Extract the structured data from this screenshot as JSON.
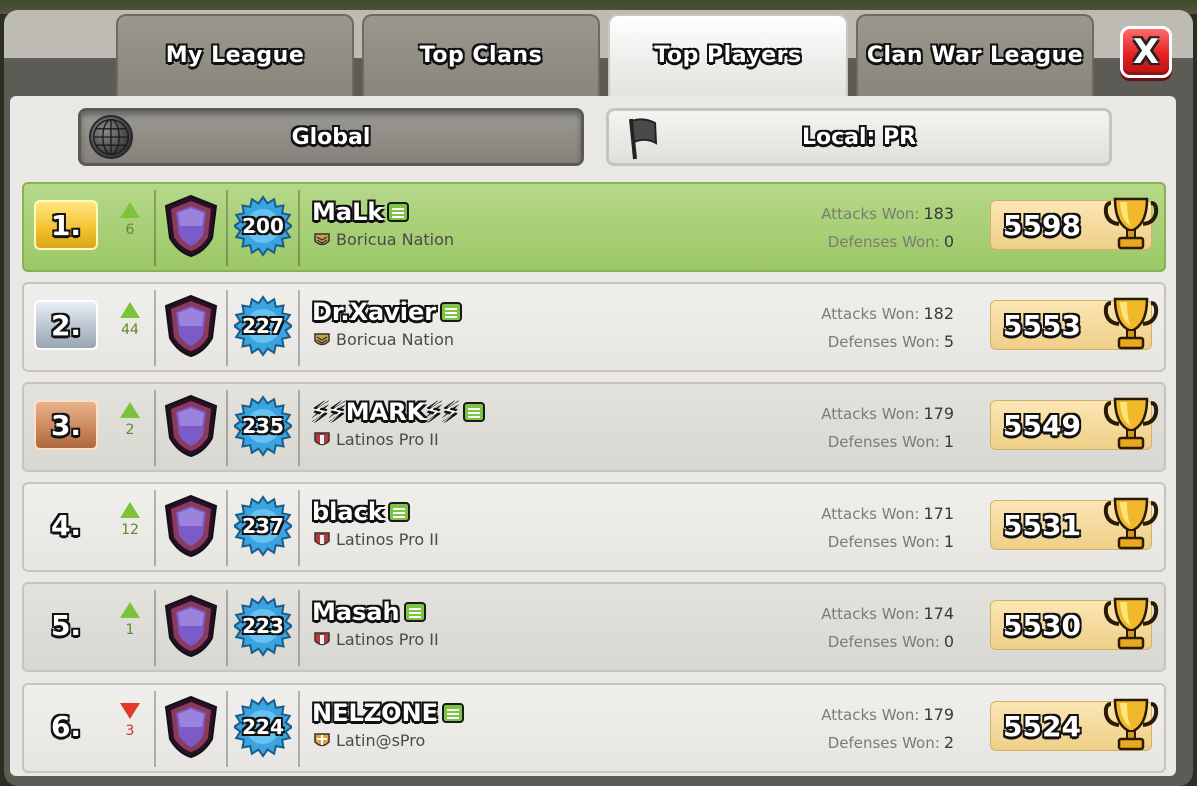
{
  "tabs": [
    {
      "label": "My League",
      "active": false
    },
    {
      "label": "Top Clans",
      "active": false
    },
    {
      "label": "Top Players",
      "active": true
    },
    {
      "label": "Clan War League",
      "active": false
    }
  ],
  "close_label": "X",
  "filters": {
    "global_label": "Global",
    "local_label": "Local: PR"
  },
  "stat_labels": {
    "attacks": "Attacks Won:",
    "defenses": "Defenses Won:"
  },
  "players": [
    {
      "rank": "1.",
      "trend": "up",
      "trend_value": "6",
      "level": "200",
      "name": "MaLk",
      "clan": "Boricua Nation",
      "attacks": "183",
      "defenses": "0",
      "trophies": "5598"
    },
    {
      "rank": "2.",
      "trend": "up",
      "trend_value": "44",
      "level": "227",
      "name": "Dr.Xavier",
      "clan": "Boricua Nation",
      "attacks": "182",
      "defenses": "5",
      "trophies": "5553"
    },
    {
      "rank": "3.",
      "trend": "up",
      "trend_value": "2",
      "level": "235",
      "name": "⚡⚡MARK⚡⚡",
      "clan": "Latinos Pro II",
      "attacks": "179",
      "defenses": "1",
      "trophies": "5549"
    },
    {
      "rank": "4.",
      "trend": "up",
      "trend_value": "12",
      "level": "237",
      "name": "black",
      "clan": "Latinos Pro II",
      "attacks": "171",
      "defenses": "1",
      "trophies": "5531"
    },
    {
      "rank": "5.",
      "trend": "up",
      "trend_value": "1",
      "level": "223",
      "name": "Masah",
      "clan": "Latinos Pro II",
      "attacks": "174",
      "defenses": "0",
      "trophies": "5530"
    },
    {
      "rank": "6.",
      "trend": "down",
      "trend_value": "3",
      "level": "224",
      "name": "NELZONE",
      "clan": "Latin@sPro",
      "attacks": "179",
      "defenses": "2",
      "trophies": "5524"
    }
  ],
  "colors": {
    "first_row": "#9cc866",
    "trend_up": "#7dc23b",
    "trend_down": "#e23a2a",
    "close_button": "#e52222"
  },
  "icons": {
    "globe": "globe-icon",
    "flag": "flag-icon",
    "league": "legend-league-shield-icon",
    "level": "xp-star-icon",
    "chat": "chat-icon",
    "trophy": "trophy-icon"
  }
}
